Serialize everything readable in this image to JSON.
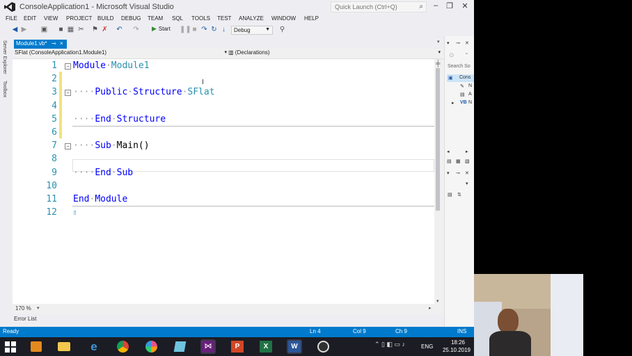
{
  "window": {
    "title": "ConsoleApplication1 - Microsoft Visual Studio",
    "quick_launch_placeholder": "Quick Launch (Ctrl+Q)"
  },
  "menu": [
    "FILE",
    "EDIT",
    "VIEW",
    "PROJECT",
    "BUILD",
    "DEBUG",
    "TEAM",
    "SQL",
    "TOOLS",
    "TEST",
    "ANALYZE",
    "WINDOW",
    "HELP"
  ],
  "toolbar": {
    "start_label": "Start",
    "config_value": "Debug"
  },
  "left_rail": [
    "Server Explorer",
    "Toolbox"
  ],
  "document_tab": {
    "label": "Module1.vb*",
    "pin": "⊸",
    "close": "×"
  },
  "navbar": {
    "left": "SFlat (ConsoleApplication1.Module1)",
    "right": "(Declarations)"
  },
  "editor": {
    "line_numbers": [
      "1",
      "2",
      "3",
      "4",
      "5",
      "6",
      "7",
      "8",
      "9",
      "10",
      "11",
      "12"
    ],
    "zoom": "170 %"
  },
  "error_list_label": "Error List",
  "right_panel": {
    "search_placeholder": "Search So",
    "item1": "Cons",
    "item2": "N",
    "item3": "A",
    "item4": "N"
  },
  "status": {
    "ready": "Ready",
    "ln": "Ln 4",
    "col": "Col 9",
    "ch": "Ch 9",
    "mode": "INS"
  },
  "taskbar": {
    "lang": "ENG",
    "time": "18:26",
    "date": "25.10.2019"
  },
  "colors": {
    "accent": "#007acc",
    "keyword": "#0000ff",
    "type": "#2b91af",
    "line_number": "#2b91af"
  }
}
